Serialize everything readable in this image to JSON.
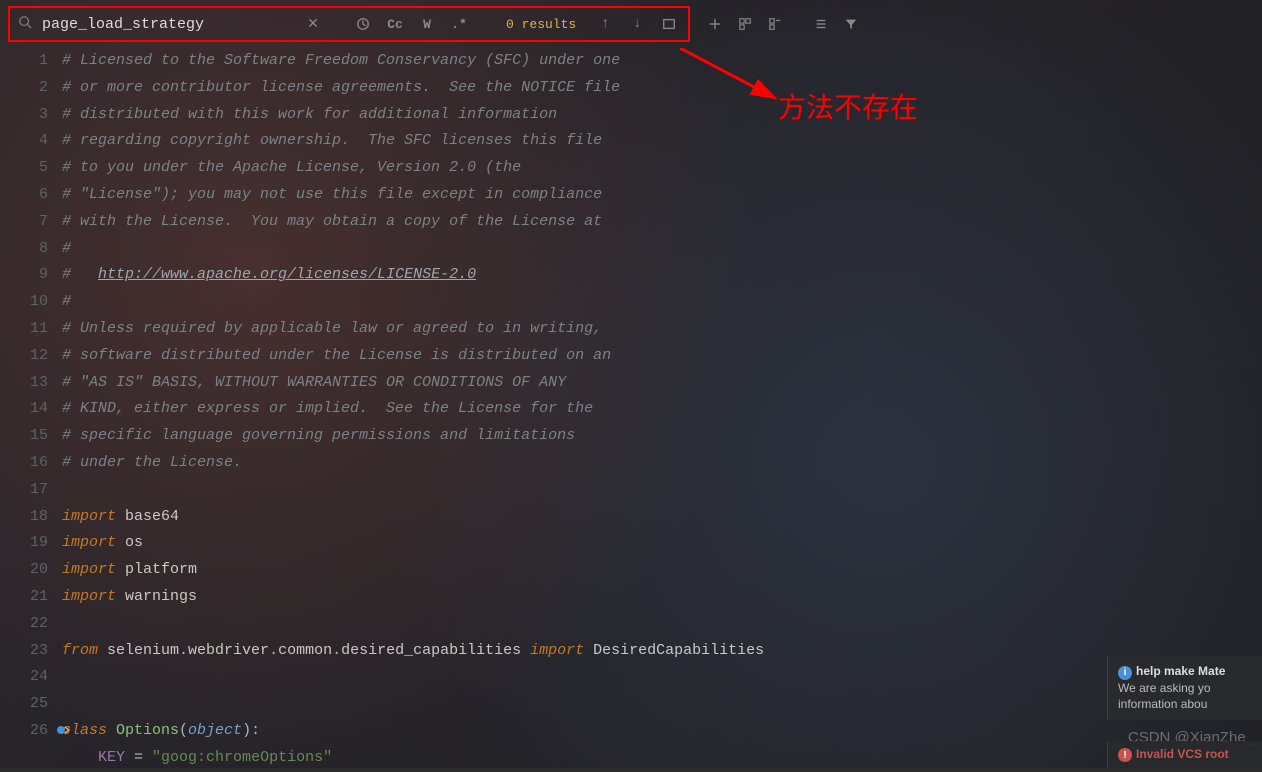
{
  "search": {
    "value": "page_load_strategy",
    "results": "0 results"
  },
  "toolbar_labels": {
    "cc": "Cc",
    "w": "W",
    "regex": ".*"
  },
  "annotation": "方法不存在",
  "code": {
    "lines": [
      {
        "n": "1",
        "seg": [
          [
            "comment",
            "# Licensed to the Software Freedom Conservancy (SFC) under one"
          ]
        ]
      },
      {
        "n": "2",
        "seg": [
          [
            "comment",
            "# or more contributor license agreements.  See the NOTICE file"
          ]
        ]
      },
      {
        "n": "3",
        "seg": [
          [
            "comment",
            "# distributed with this work for additional information"
          ]
        ]
      },
      {
        "n": "4",
        "seg": [
          [
            "comment",
            "# regarding copyright ownership.  The SFC licenses this file"
          ]
        ]
      },
      {
        "n": "5",
        "seg": [
          [
            "comment",
            "# to you under the Apache License, Version 2.0 (the"
          ]
        ]
      },
      {
        "n": "6",
        "seg": [
          [
            "comment",
            "# \"License\"); you may not use this file except in compliance"
          ]
        ]
      },
      {
        "n": "7",
        "seg": [
          [
            "comment",
            "# with the License.  You may obtain a copy of the License at"
          ]
        ]
      },
      {
        "n": "8",
        "seg": [
          [
            "comment",
            "#"
          ]
        ]
      },
      {
        "n": "9",
        "seg": [
          [
            "comment",
            "#   "
          ],
          [
            "link",
            "http://www.apache.org/licenses/LICENSE-2.0"
          ]
        ]
      },
      {
        "n": "10",
        "seg": [
          [
            "comment",
            "#"
          ]
        ]
      },
      {
        "n": "11",
        "seg": [
          [
            "comment",
            "# Unless required by applicable law or agreed to in writing,"
          ]
        ]
      },
      {
        "n": "12",
        "seg": [
          [
            "comment",
            "# software distributed under the License is distributed on an"
          ]
        ]
      },
      {
        "n": "13",
        "seg": [
          [
            "comment",
            "# \"AS IS\" BASIS, WITHOUT WARRANTIES OR CONDITIONS OF ANY"
          ]
        ]
      },
      {
        "n": "14",
        "seg": [
          [
            "comment",
            "# KIND, either express or implied.  See the License for the"
          ]
        ]
      },
      {
        "n": "15",
        "seg": [
          [
            "comment",
            "# specific language governing permissions and limitations"
          ]
        ]
      },
      {
        "n": "16",
        "seg": [
          [
            "comment",
            "# under the License."
          ]
        ]
      },
      {
        "n": "17",
        "seg": []
      },
      {
        "n": "18",
        "seg": [
          [
            "kw",
            "import "
          ],
          [
            "mod",
            "base64"
          ]
        ]
      },
      {
        "n": "19",
        "seg": [
          [
            "kw",
            "import "
          ],
          [
            "mod",
            "os"
          ]
        ]
      },
      {
        "n": "20",
        "seg": [
          [
            "kw",
            "import "
          ],
          [
            "mod",
            "platform"
          ]
        ]
      },
      {
        "n": "21",
        "seg": [
          [
            "kw",
            "import "
          ],
          [
            "mod",
            "warnings"
          ]
        ]
      },
      {
        "n": "22",
        "seg": []
      },
      {
        "n": "23",
        "seg": [
          [
            "kw",
            "from "
          ],
          [
            "mod",
            "selenium"
          ],
          [
            "punct",
            "."
          ],
          [
            "mod",
            "webdriver"
          ],
          [
            "punct",
            "."
          ],
          [
            "mod",
            "common"
          ],
          [
            "punct",
            "."
          ],
          [
            "mod",
            "desired_capabilities"
          ],
          [
            "kw",
            " import "
          ],
          [
            "mod",
            "DesiredCapabilities"
          ]
        ]
      },
      {
        "n": "24",
        "seg": []
      },
      {
        "n": "25",
        "seg": []
      },
      {
        "n": "26",
        "seg": [
          [
            "kw",
            "class "
          ],
          [
            "cls",
            "Options"
          ],
          [
            "punct",
            "("
          ],
          [
            "param",
            "object"
          ],
          [
            "punct",
            "):"
          ]
        ],
        "icon": true
      },
      {
        "n": "",
        "seg": [
          [
            "normal",
            "    "
          ],
          [
            "const",
            "KEY"
          ],
          [
            "punct",
            " = "
          ],
          [
            "str",
            "\"goog:chromeOptions\""
          ]
        ]
      }
    ]
  },
  "notification": {
    "title": "help make Mate",
    "body1": "We are asking yo",
    "body2": "information abou"
  },
  "error_notification": "Invalid VCS root",
  "watermark": "CSDN @XianZhe_"
}
